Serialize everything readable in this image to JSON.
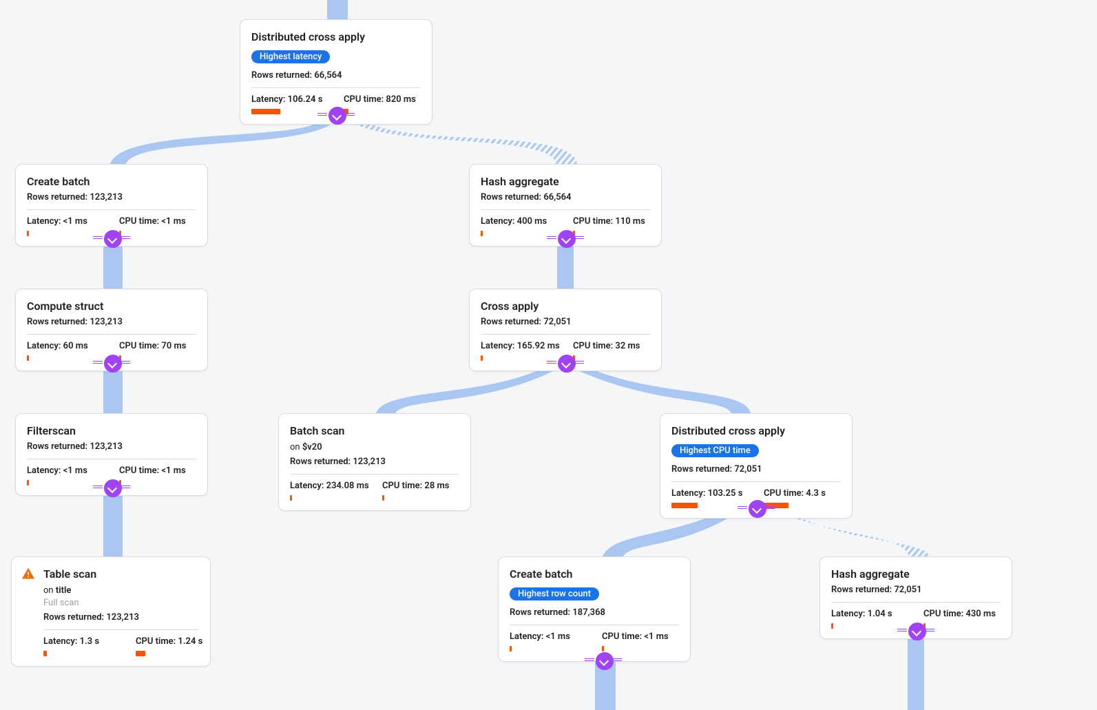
{
  "texts": {
    "on": "on",
    "rows_label": "Rows returned: ",
    "latency_label": "Latency: ",
    "cpu_label": "CPU time: "
  },
  "nodes": {
    "n1": {
      "title": "Distributed cross apply",
      "badge": "Highest latency",
      "rows": "66,564",
      "latency": "106.24 s",
      "cpu": "820 ms",
      "latBar": 42,
      "cpuBar": 7
    },
    "n2": {
      "title": "Create batch",
      "rows": "123,213",
      "latency": "<1 ms",
      "cpu": "<1 ms",
      "latBar": 3,
      "cpuBar": 3
    },
    "n3": {
      "title": "Hash aggregate",
      "rows": "66,564",
      "latency": "400 ms",
      "cpu": "110 ms",
      "latBar": 3,
      "cpuBar": 3
    },
    "n4": {
      "title": "Compute struct",
      "rows": "123,213",
      "latency": "60 ms",
      "cpu": "70 ms",
      "latBar": 3,
      "cpuBar": 3
    },
    "n5": {
      "title": "Cross apply",
      "rows": "72,051",
      "latency": "165.92 ms",
      "cpu": "32 ms",
      "latBar": 3,
      "cpuBar": 3
    },
    "n6": {
      "title": "Filterscan",
      "rows": "123,213",
      "latency": "<1 ms",
      "cpu": "<1 ms",
      "latBar": 3,
      "cpuBar": 3
    },
    "n7": {
      "title": "Batch scan",
      "on": "$v20",
      "rows": "123,213",
      "latency": "234.08 ms",
      "cpu": "28 ms",
      "latBar": 3,
      "cpuBar": 3
    },
    "n8": {
      "title": "Distributed cross apply",
      "badge": "Highest CPU time",
      "rows": "72,051",
      "latency": "103.25 s",
      "cpu": "4.3 s",
      "latBar": 38,
      "cpuBar": 36
    },
    "n9": {
      "title": "Table scan",
      "on": "title",
      "subnote": "Full scan",
      "rows": "123,213",
      "latency": "1.3 s",
      "cpu": "1.24 s",
      "latBar": 5,
      "cpuBar": 14,
      "warning": true
    },
    "n10": {
      "title": "Create batch",
      "badge": "Highest row count",
      "rows": "187,368",
      "latency": "<1 ms",
      "cpu": "<1 ms",
      "latBar": 3,
      "cpuBar": 3
    },
    "n11": {
      "title": "Hash aggregate",
      "rows": "72,051",
      "latency": "1.04 s",
      "cpu": "430 ms",
      "latBar": 3,
      "cpuBar": 3
    }
  }
}
